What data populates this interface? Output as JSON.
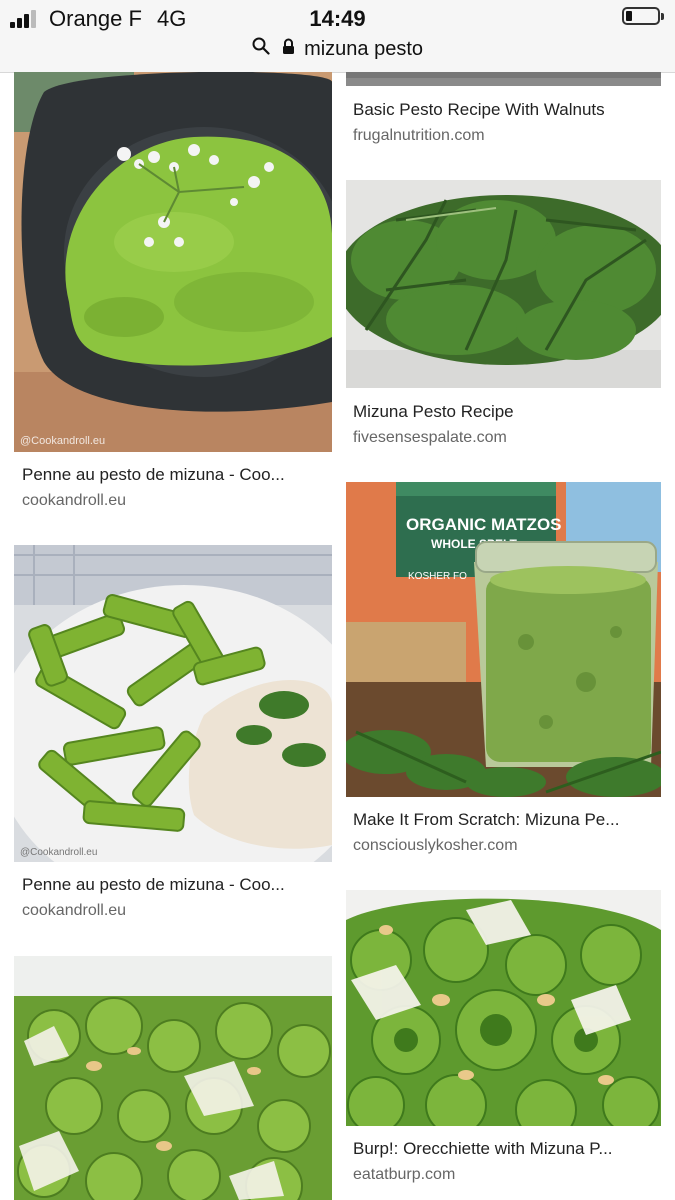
{
  "status_bar": {
    "carrier": "Orange F",
    "network": "4G",
    "time": "14:49",
    "battery_level": 0.2
  },
  "address_bar": {
    "query": "mizuna pesto",
    "icons": [
      "search-icon",
      "lock-icon"
    ]
  },
  "results": {
    "left": [
      {
        "title": "Penne au pesto de mizuna - Coo...",
        "site": "cookandroll.eu",
        "watermark": "@Cookandroll.eu"
      },
      {
        "title": "Penne au pesto de mizuna - Coo...",
        "site": "cookandroll.eu",
        "watermark": "@Cookandroll.eu"
      },
      {
        "title": "",
        "site": ""
      }
    ],
    "right": [
      {
        "title": "Basic Pesto Recipe With Walnuts",
        "site": "frugalnutrition.com"
      },
      {
        "title": "Mizuna Pesto Recipe",
        "site": "fivesensespalate.com"
      },
      {
        "title": "Make It From Scratch: Mizuna Pe...",
        "site": "consciouslykosher.com",
        "package_lines": [
          "ORGANIC MATZOS",
          "WHOLE SPELT",
          "KOSHER FO"
        ]
      },
      {
        "title": "Burp!: Orecchiette with Mizuna P...",
        "site": "eatatburp.com"
      }
    ]
  },
  "colors": {
    "pesto": "#7fb83a",
    "pesto_dark": "#4f8a22",
    "link_text": "#222222",
    "site_text": "#666666"
  }
}
